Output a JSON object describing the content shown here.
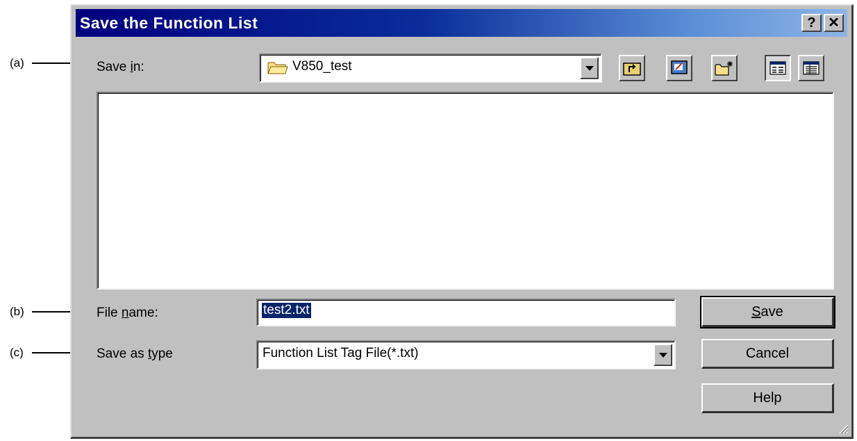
{
  "callouts": [
    {
      "tag": "(a)"
    },
    {
      "tag": "(b)"
    },
    {
      "tag": "(c)"
    }
  ],
  "dialog": {
    "title": "Save the Function List",
    "help_button": "?",
    "close_button": "✕"
  },
  "save_in": {
    "label_pre": "Save ",
    "label_key": "i",
    "label_post": "n:",
    "value": "V850_test"
  },
  "toolbar": {
    "items": [
      "up-one-level",
      "desktop",
      "create-new-folder",
      "list-view",
      "details-view"
    ]
  },
  "file_name": {
    "label_pre": "File ",
    "label_key": "n",
    "label_post": "ame:",
    "value": "test2.txt"
  },
  "save_as_type": {
    "label_pre": "Save as ",
    "label_key": "t",
    "label_post": "ype",
    "value": "Function List Tag File(*.txt)"
  },
  "buttons": {
    "save_key": "S",
    "save_rest": "ave",
    "cancel": "Cancel",
    "help": "Help"
  },
  "colors": {
    "titlebar_start": "#00007e",
    "titlebar_end": "#8fb4e6",
    "face": "#c0c0c0",
    "selection": "#0a246a"
  }
}
